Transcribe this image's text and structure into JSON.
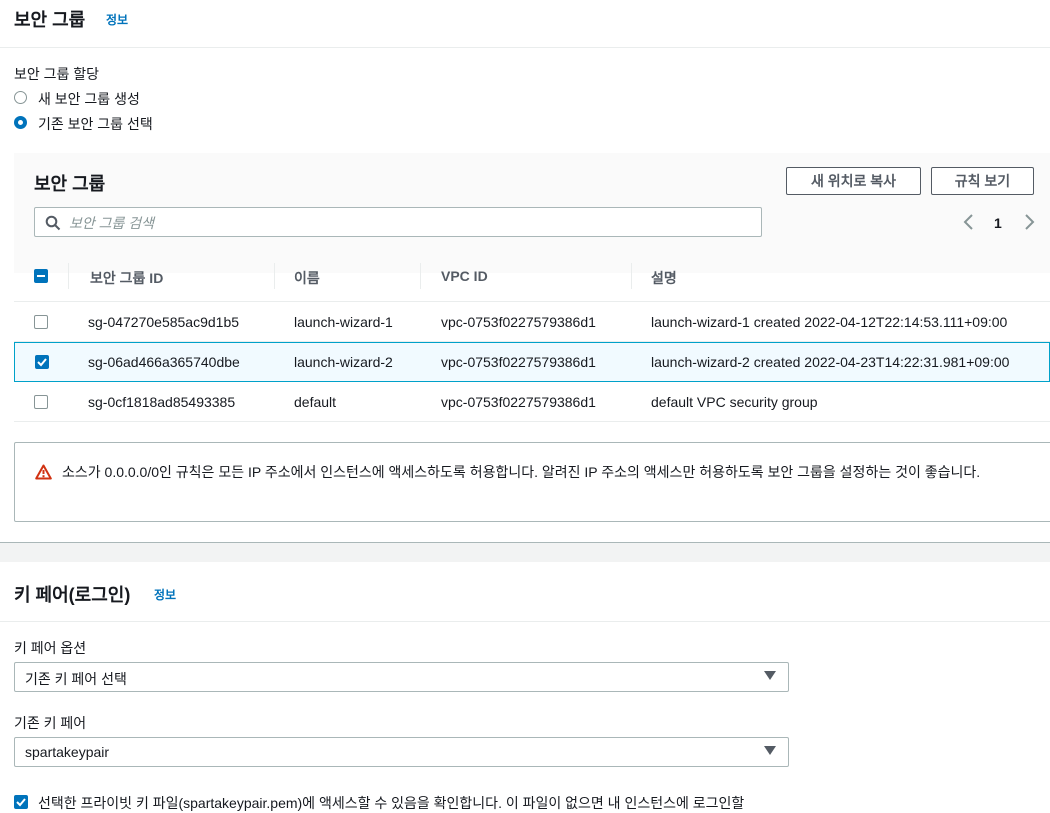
{
  "security_group_section": {
    "title": "보안 그룹",
    "info": "정보",
    "assignment_label": "보안 그룹 할당",
    "radio_options": [
      {
        "label": "새 보안 그룹 생성",
        "selected": false
      },
      {
        "label": "기존 보안 그룹 선택",
        "selected": true
      }
    ],
    "table": {
      "title": "보안 그룹",
      "copy_button": "새 위치로 복사",
      "view_rules_button": "규칙 보기",
      "search_placeholder": "보안 그룹 검색",
      "page": "1",
      "columns": [
        "보안 그룹 ID",
        "이름",
        "VPC ID",
        "설명"
      ],
      "rows": [
        {
          "id": "sg-047270e585ac9d1b5",
          "name": "launch-wizard-1",
          "vpc": "vpc-0753f0227579386d1",
          "desc": "launch-wizard-1 created 2022-04-12T22:14:53.111+09:00",
          "checked": false
        },
        {
          "id": "sg-06ad466a365740dbe",
          "name": "launch-wizard-2",
          "vpc": "vpc-0753f0227579386d1",
          "desc": "launch-wizard-2 created 2022-04-23T14:22:31.981+09:00",
          "checked": true
        },
        {
          "id": "sg-0cf1818ad85493385",
          "name": "default",
          "vpc": "vpc-0753f0227579386d1",
          "desc": "default VPC security group",
          "checked": false
        }
      ]
    },
    "warning": "소스가 0.0.0.0/0인 규칙은 모든 IP 주소에서 인스턴스에 액세스하도록 허용합니다. 알려진 IP 주소의 액세스만 허용하도록 보안 그룹을 설정하는 것이 좋습니다."
  },
  "key_pair_section": {
    "title": "키 페어(로그인)",
    "info": "정보",
    "option_label": "키 페어 옵션",
    "option_value": "기존 키 페어 선택",
    "existing_label": "기존 키 페어",
    "existing_value": "spartakeypair",
    "ack_text": "선택한 프라이빗 키 파일(spartakeypair.pem)에 액세스할 수 있음을 확인합니다. 이 파일이 없으면 내 인스턴스에 로그인할"
  },
  "colors": {
    "accent": "#0073bb",
    "warning": "#d13212",
    "selected_row": "#f1faff"
  }
}
